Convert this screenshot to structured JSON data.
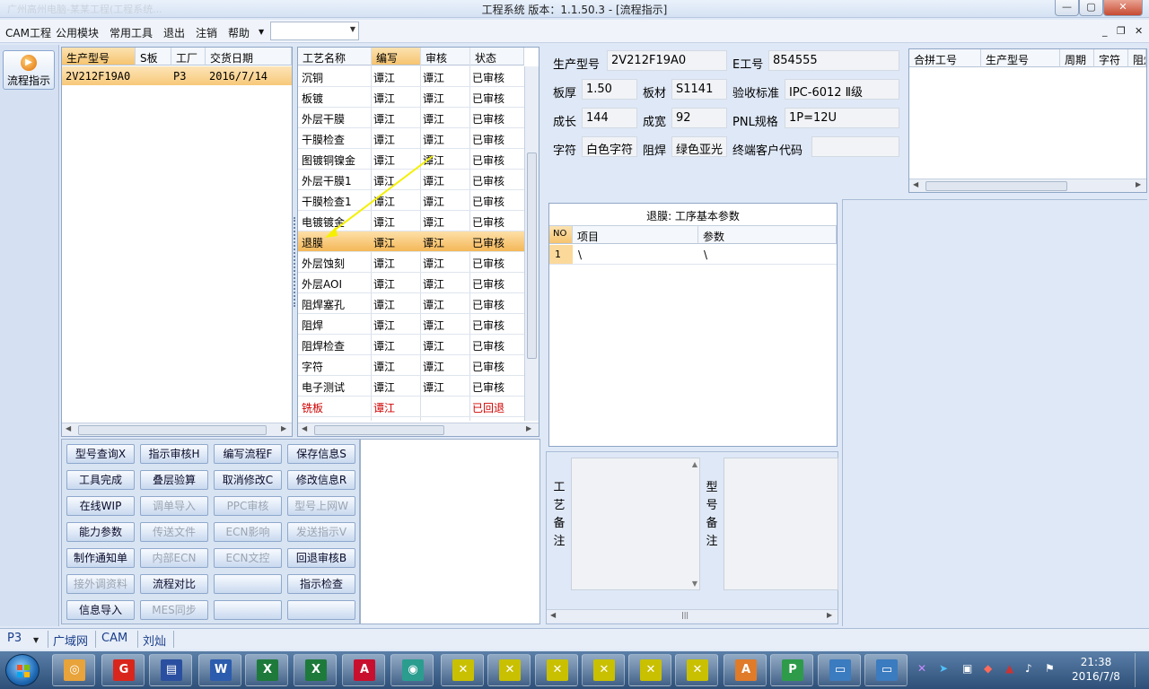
{
  "window": {
    "title": "工程系统   版本：1.1.50.3 - [流程指示]",
    "ghost_text": "广州高州电脑-某某工程(工程系统..."
  },
  "menu": {
    "items": [
      "CAM工程",
      "公用模块",
      "常用工具",
      "退出",
      "注销",
      "帮助"
    ],
    "combo_value": ""
  },
  "navbar": {
    "label": "流程指示"
  },
  "product_list": {
    "headers": [
      "生产型号",
      "S板",
      "工厂",
      "交货日期"
    ],
    "rows": [
      {
        "model": "2V212F19A0",
        "s": "",
        "factory": "P3",
        "date": "2016/7/14"
      }
    ]
  },
  "process_list": {
    "headers": [
      "工艺名称",
      "编写",
      "审核",
      "状态"
    ],
    "rows": [
      {
        "name": "沉铜",
        "writer": "谭江",
        "reviewer": "谭江",
        "status": "已审核"
      },
      {
        "name": "板镀",
        "writer": "谭江",
        "reviewer": "谭江",
        "status": "已审核"
      },
      {
        "name": "外层干膜",
        "writer": "谭江",
        "reviewer": "谭江",
        "status": "已审核"
      },
      {
        "name": "干膜检查",
        "writer": "谭江",
        "reviewer": "谭江",
        "status": "已审核"
      },
      {
        "name": "图镀铜镍金",
        "writer": "谭江",
        "reviewer": "谭江",
        "status": "已审核"
      },
      {
        "name": "外层干膜1",
        "writer": "谭江",
        "reviewer": "谭江",
        "status": "已审核"
      },
      {
        "name": "干膜检查1",
        "writer": "谭江",
        "reviewer": "谭江",
        "status": "已审核"
      },
      {
        "name": "电镀镀金",
        "writer": "谭江",
        "reviewer": "谭江",
        "status": "已审核"
      },
      {
        "name": "退膜",
        "writer": "谭江",
        "reviewer": "谭江",
        "status": "已审核"
      },
      {
        "name": "外层蚀刻",
        "writer": "谭江",
        "reviewer": "谭江",
        "status": "已审核"
      },
      {
        "name": "外层AOI",
        "writer": "谭江",
        "reviewer": "谭江",
        "status": "已审核"
      },
      {
        "name": "阻焊塞孔",
        "writer": "谭江",
        "reviewer": "谭江",
        "status": "已审核"
      },
      {
        "name": "阻焊",
        "writer": "谭江",
        "reviewer": "谭江",
        "status": "已审核"
      },
      {
        "name": "阻焊检查",
        "writer": "谭江",
        "reviewer": "谭江",
        "status": "已审核"
      },
      {
        "name": "字符",
        "writer": "谭江",
        "reviewer": "谭江",
        "status": "已审核"
      },
      {
        "name": "电子测试",
        "writer": "谭江",
        "reviewer": "谭江",
        "status": "已审核"
      },
      {
        "name": "铣板",
        "writer": "谭江",
        "reviewer": "",
        "status": "已回退"
      }
    ]
  },
  "buttons": [
    [
      "型号查询X",
      "指示审核H",
      "编写流程F",
      "保存信息S"
    ],
    [
      "工具完成",
      "叠层验算",
      "取消修改C",
      "修改信息R"
    ],
    [
      "在线WIP",
      "调单导入",
      "PPC审核",
      "型号上网W"
    ],
    [
      "能力参数",
      "传送文件",
      "ECN影响",
      "发送指示V"
    ],
    [
      "制作通知单",
      "内部ECN",
      "ECN文控",
      "回退审核B"
    ],
    [
      "接外调资料",
      "流程对比",
      "",
      "指示检查"
    ],
    [
      "信息导入",
      "MES同步",
      "",
      ""
    ]
  ],
  "info": {
    "fields": [
      {
        "label": "生产型号",
        "value": "2V212F19A0"
      },
      {
        "label": "E工号",
        "value": "854555"
      },
      {
        "label": "板厚",
        "value": "1.50"
      },
      {
        "label": "板材",
        "value": "S1141"
      },
      {
        "label": "验收标准",
        "value": "IPC-6012 Ⅱ级"
      },
      {
        "label": "成长",
        "value": "144"
      },
      {
        "label": "成宽",
        "value": "92"
      },
      {
        "label": "PNL规格",
        "value": "1P=12U"
      },
      {
        "label": "字符",
        "value": "白色字符"
      },
      {
        "label": "阻焊",
        "value": "绿色亚光"
      },
      {
        "label": "终端客户代码",
        "value": ""
      }
    ]
  },
  "merge_grid": {
    "headers": [
      "合拼工号",
      "生产型号",
      "周期",
      "字符",
      "阻焊"
    ]
  },
  "params": {
    "title": "退膜: 工序基本参数",
    "headers": [
      "NO",
      "项目",
      "参数"
    ],
    "rows": [
      {
        "no": "1",
        "item": "\\",
        "param": "\\"
      }
    ]
  },
  "notes": {
    "process_label": "工艺备注",
    "model_label": "型号备注"
  },
  "statusbar": {
    "factory": "P3",
    "items": [
      "广域网",
      "CAM",
      "刘灿"
    ]
  },
  "taskbar": {
    "time": "21:38",
    "date": "2016/7/8"
  }
}
